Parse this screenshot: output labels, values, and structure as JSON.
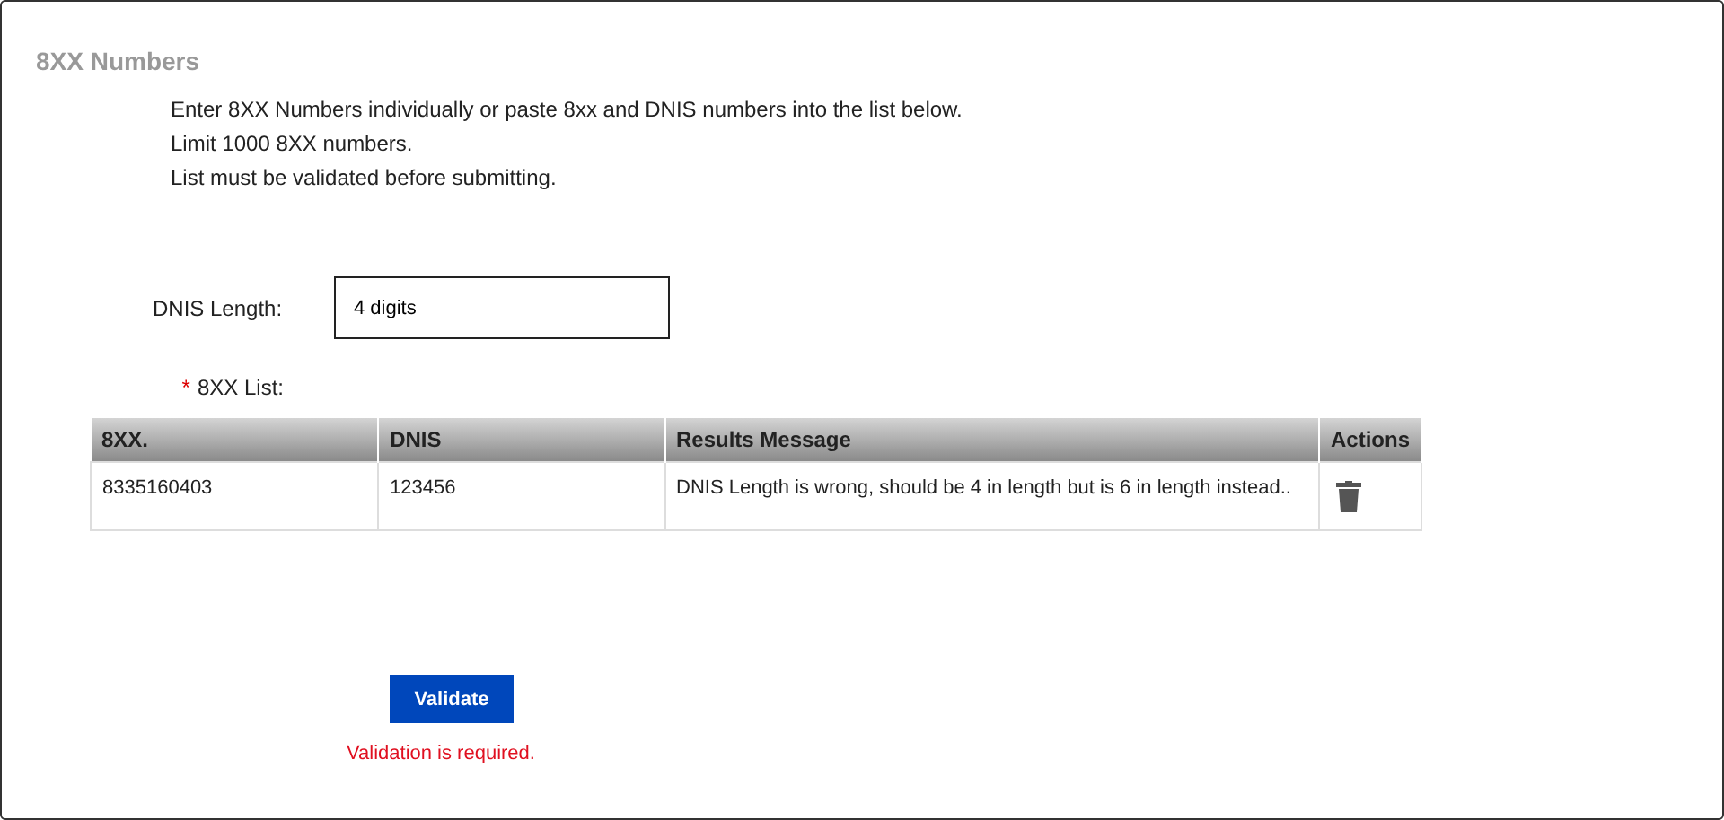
{
  "section": {
    "title": "8XX Numbers"
  },
  "instructions": [
    "Enter 8XX Numbers individually or paste 8xx and DNIS numbers into the list below.",
    "Limit 1000 8XX numbers.",
    "List must be validated before submitting."
  ],
  "dnis_length": {
    "label": "DNIS Length:",
    "value": "4 digits"
  },
  "list": {
    "required_mark": "*",
    "label": "8XX List:",
    "columns": [
      "8XX.",
      "DNIS",
      "Results Message",
      "Actions"
    ],
    "rows": [
      {
        "number": "8335160403",
        "dnis": "123456",
        "message": "DNIS Length is wrong, should be 4 in length but is 6 in length instead.."
      }
    ]
  },
  "validate_button": "Validate",
  "error": "Validation is required."
}
